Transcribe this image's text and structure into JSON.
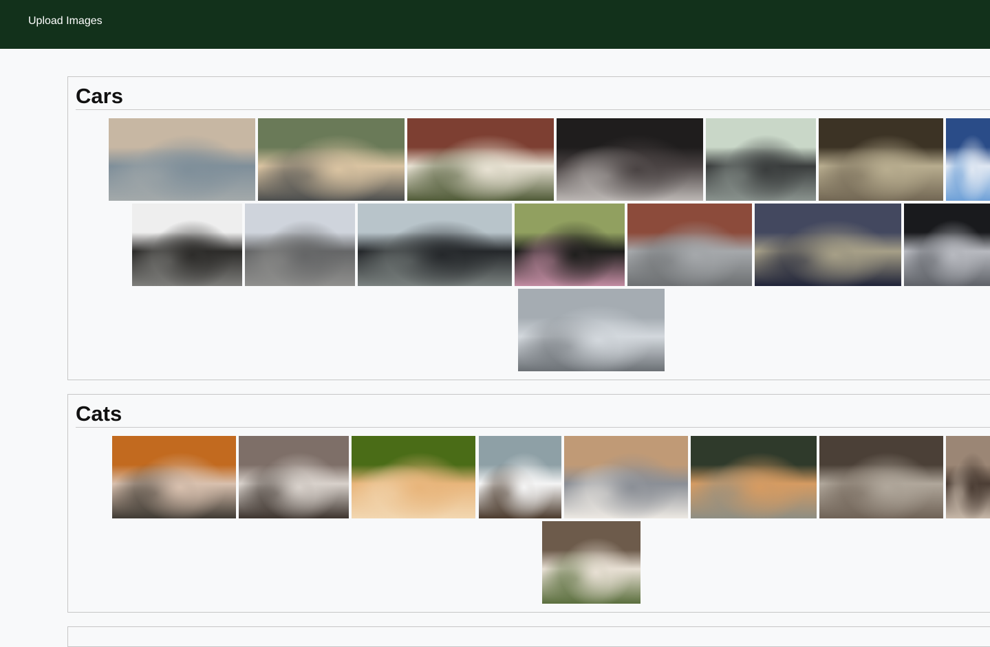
{
  "nav": {
    "upload_label": "Upload Images"
  },
  "sections": [
    {
      "title": "Cars",
      "images": [
        {
          "subject": "silver-vintage-sedan",
          "colors": [
            "#c7b7a3",
            "#7f8f9a",
            "#a3a9aa"
          ]
        },
        {
          "subject": "champagne-sedan",
          "colors": [
            "#6a7a58",
            "#d9c3a1",
            "#4b4d4d"
          ]
        },
        {
          "subject": "white-sedan-brick-house",
          "colors": [
            "#7d3f32",
            "#e7e1d2",
            "#4f5a37"
          ]
        },
        {
          "subject": "black-sport-sedan",
          "colors": [
            "#1f1d1d",
            "#4a4343",
            "#bdb8b5"
          ]
        },
        {
          "subject": "black-coupe",
          "colors": [
            "#c9d7c8",
            "#3a3d3d",
            "#8a938e"
          ]
        },
        {
          "subject": "car-interior",
          "colors": [
            "#3c3325",
            "#b8ad8f",
            "#726754"
          ]
        },
        {
          "subject": "blue-sedan-partial",
          "colors": [
            "#2a4c88",
            "#dfe7f2",
            "#6ea0d7"
          ]
        },
        {
          "subject": "black-suv",
          "colors": [
            "#eeeeee",
            "#2d2c2a",
            "#7d7d7a"
          ]
        },
        {
          "subject": "gray-sedan-harbor",
          "colors": [
            "#cfd4dc",
            "#656667",
            "#8f8f8d"
          ]
        },
        {
          "subject": "black-coupe-road",
          "colors": [
            "#b8c4ca",
            "#25282b",
            "#7a817f"
          ]
        },
        {
          "subject": "black-sedan-blossom",
          "colors": [
            "#91a060",
            "#1f1f1d",
            "#c28ca2"
          ]
        },
        {
          "subject": "silver-sedan-brick-wall",
          "colors": [
            "#8c4b3b",
            "#a5a8ab",
            "#6d7072"
          ]
        },
        {
          "subject": "blue-interior",
          "colors": [
            "#43485f",
            "#a69f87",
            "#1f2338"
          ]
        },
        {
          "subject": "silver-sedan-dark",
          "colors": [
            "#191a1d",
            "#b7b9bf",
            "#5e6167"
          ]
        },
        {
          "subject": "silver-rear-sedan",
          "colors": [
            "#a5acb2",
            "#d3d8dd",
            "#6b7075"
          ]
        }
      ]
    },
    {
      "title": "Cats",
      "images": [
        {
          "subject": "kitten-on-laptop",
          "colors": [
            "#c26a1f",
            "#d8c0ae",
            "#3f3a33"
          ]
        },
        {
          "subject": "scottish-fold",
          "colors": [
            "#7e6f68",
            "#d8d1cb",
            "#3d342e"
          ]
        },
        {
          "subject": "orange-kitten-paw",
          "colors": [
            "#4a6c17",
            "#e8b57b",
            "#f2d7b1"
          ]
        },
        {
          "subject": "surprised-cat",
          "colors": [
            "#8ea0a6",
            "#f4f4f4",
            "#4b3a2c"
          ]
        },
        {
          "subject": "gray-kitten",
          "colors": [
            "#c09a76",
            "#8b8f96",
            "#ede9e3"
          ]
        },
        {
          "subject": "sleeping-kittens",
          "colors": [
            "#2f3a2b",
            "#d59b62",
            "#8e8e83"
          ]
        },
        {
          "subject": "tabby-cat",
          "colors": [
            "#4b4037",
            "#b0a79b",
            "#6f6256"
          ]
        },
        {
          "subject": "partial-tabby",
          "colors": [
            "#9b8675",
            "#4c3e35",
            "#c7b8a9"
          ]
        },
        {
          "subject": "tabby-portrait",
          "colors": [
            "#6d5b4b",
            "#e7dfd3",
            "#5a6e3d"
          ]
        }
      ]
    }
  ]
}
